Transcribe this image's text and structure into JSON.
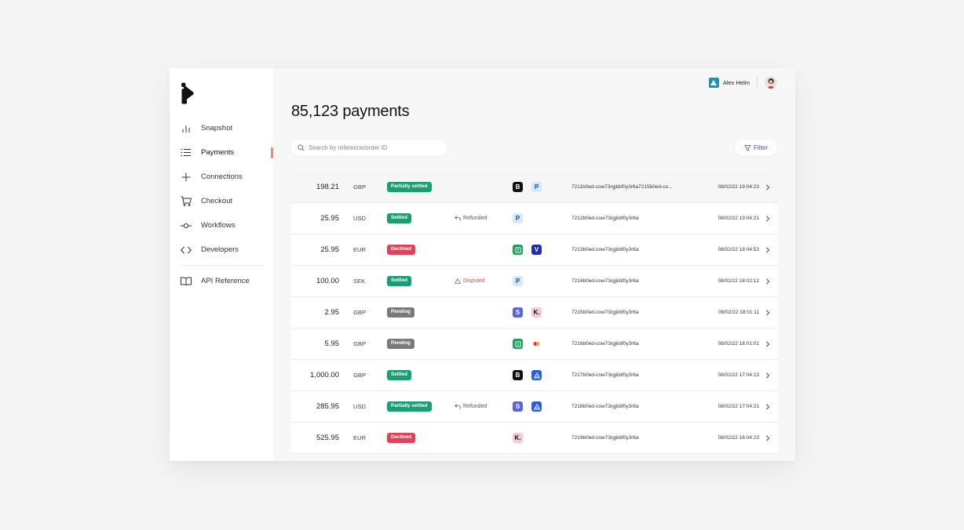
{
  "colors": {
    "accent": "#3d55d8",
    "nav_active": "#f08a72",
    "settled": "#1a9e72",
    "declined": "#e0425a",
    "pending": "#7a7a7a",
    "disputed": "#d94c4c"
  },
  "sidebar": {
    "items": [
      {
        "label": "Snapshot",
        "icon": "bar-chart-icon"
      },
      {
        "label": "Payments",
        "icon": "list-icon",
        "active": true
      },
      {
        "label": "Connections",
        "icon": "plus-icon"
      },
      {
        "label": "Checkout",
        "icon": "cart-icon"
      },
      {
        "label": "Workflows",
        "icon": "commit-icon"
      },
      {
        "label": "Developers",
        "icon": "code-icon"
      }
    ],
    "secondary": [
      {
        "label": "API Reference",
        "icon": "book-icon"
      }
    ]
  },
  "header": {
    "user_name": "Alex Helm"
  },
  "main": {
    "title": "85,123 payments",
    "search_placeholder": "Search by reference/order ID",
    "filter_label": "Filter"
  },
  "payments": [
    {
      "amount": "198.21",
      "currency": "GBP",
      "status": "Partially settled",
      "status_type": "settled",
      "note": "",
      "methods": [
        "bank-b",
        "paypal"
      ],
      "reference": "7211b0ed-cow73rgjkbf0y3r6a7215b0ed-co...",
      "timestamp": "08/02/22 19:04:23"
    },
    {
      "amount": "25.95",
      "currency": "USD",
      "status": "Settled",
      "status_type": "settled",
      "note": "Refunded",
      "note_type": "refunded",
      "methods": [
        "paypal"
      ],
      "reference": "7212b0ed-cow73rgjkbf0y3r6a",
      "timestamp": "08/02/22 19:04:21"
    },
    {
      "amount": "25.95",
      "currency": "EUR",
      "status": "Declined",
      "status_type": "declined",
      "note": "",
      "methods": [
        "green-card",
        "venmo"
      ],
      "reference": "7213b0ed-cow73rgjkbf0y3r6a",
      "timestamp": "08/02/22 18:04:53"
    },
    {
      "amount": "100.00",
      "currency": "SEK",
      "status": "Settled",
      "status_type": "settled",
      "note": "Disputed",
      "note_type": "disputed",
      "methods": [
        "paypal"
      ],
      "reference": "7214b0ed-cow73rgjkbf0y3r6a",
      "timestamp": "08/02/22 18:02:12"
    },
    {
      "amount": "2.95",
      "currency": "GBP",
      "status": "Pending",
      "status_type": "pending",
      "note": "",
      "methods": [
        "stripe",
        "klarna"
      ],
      "reference": "7215b0ed-cow73rgjkbf0y3r6a",
      "timestamp": "08/02/22 18:01:11"
    },
    {
      "amount": "5.95",
      "currency": "GBP",
      "status": "Pending",
      "status_type": "pending",
      "note": "",
      "methods": [
        "green-card",
        "mastercard"
      ],
      "reference": "7216b0ed-cow73rgjkbf0y3r6a",
      "timestamp": "08/02/22 18:01:01"
    },
    {
      "amount": "1,000.00",
      "currency": "GBP",
      "status": "Settled",
      "status_type": "settled",
      "note": "",
      "methods": [
        "bank-b",
        "affirm"
      ],
      "reference": "7217b0ed-cow73rgjkbf0y3r6a",
      "timestamp": "08/02/22 17:04:23"
    },
    {
      "amount": "285.95",
      "currency": "USD",
      "status": "Partially settled",
      "status_type": "settled",
      "note": "Refunded",
      "note_type": "refunded",
      "methods": [
        "stripe",
        "affirm"
      ],
      "reference": "7218b0ed-cow73rgjkbf0y3r6a",
      "timestamp": "08/02/22 17:04:21"
    },
    {
      "amount": "525.95",
      "currency": "EUR",
      "status": "Declined",
      "status_type": "declined",
      "note": "",
      "methods": [
        "klarna"
      ],
      "reference": "7219b0ed-cow73rgjkbf0y3r6a",
      "timestamp": "08/02/22 16:04:23"
    }
  ]
}
